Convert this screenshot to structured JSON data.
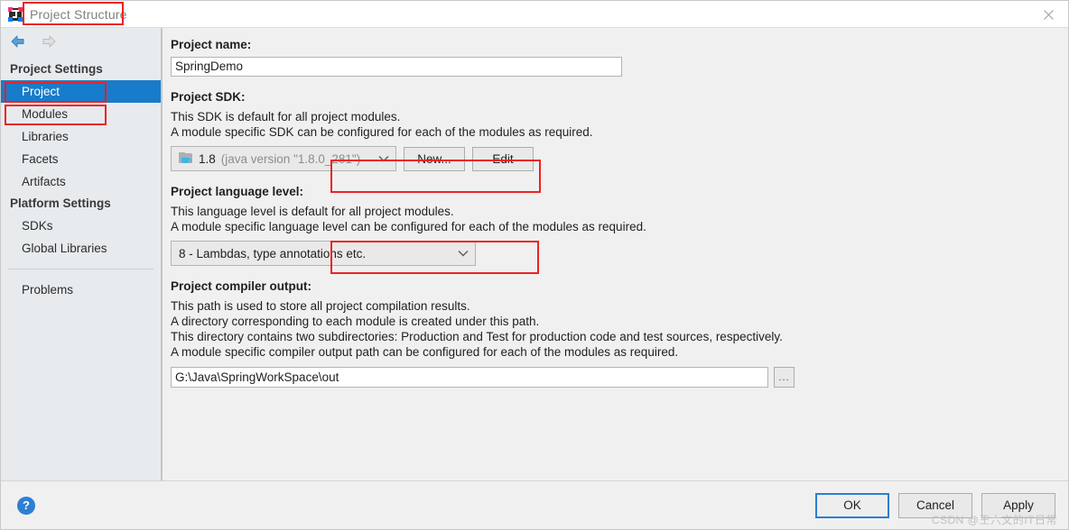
{
  "window": {
    "title": "Project Structure",
    "app_icon": "intellij-idea-icon",
    "close_label": "✕"
  },
  "sidebar": {
    "nav": {
      "back_icon": "arrow-left-icon",
      "forward_icon": "arrow-right-icon"
    },
    "groups": [
      {
        "label": "Project Settings",
        "items": [
          {
            "label": "Project",
            "selected": true
          },
          {
            "label": "Modules",
            "selected": false
          },
          {
            "label": "Libraries",
            "selected": false
          },
          {
            "label": "Facets",
            "selected": false
          },
          {
            "label": "Artifacts",
            "selected": false
          }
        ]
      },
      {
        "label": "Platform Settings",
        "items": [
          {
            "label": "SDKs",
            "selected": false
          },
          {
            "label": "Global Libraries",
            "selected": false
          }
        ]
      }
    ],
    "problems": {
      "label": "Problems"
    }
  },
  "main": {
    "project_name": {
      "label": "Project name:",
      "value": "SpringDemo",
      "placeholder": ""
    },
    "project_sdk": {
      "label": "Project SDK:",
      "desc_line1": "This SDK is default for all project modules.",
      "desc_line2": "A module specific SDK can be configured for each of the modules as required.",
      "selected_name": "1.8",
      "selected_version": "(java version \"1.8.0_281\")",
      "icon": "jdk-folder-icon",
      "dropdown_icon": "chevron-down-icon",
      "new_button": "New...",
      "edit_button": "Edit"
    },
    "language_level": {
      "label": "Project language level:",
      "desc_line1": "This language level is default for all project modules.",
      "desc_line2": "A module specific language level can be configured for each of the modules as required.",
      "selected": "8 - Lambdas, type annotations etc.",
      "dropdown_icon": "chevron-down-icon"
    },
    "compiler_output": {
      "label": "Project compiler output:",
      "desc_line1": "This path is used to store all project compilation results.",
      "desc_line2": "A directory corresponding to each module is created under this path.",
      "desc_line3": "This directory contains two subdirectories: Production and Test for production code and test sources, respectively.",
      "desc_line4": "A module specific compiler output path can be configured for each of the modules as required.",
      "value": "G:\\Java\\SpringWorkSpace\\out",
      "browse_button": "..."
    }
  },
  "footer": {
    "help_label": "?",
    "ok_label": "OK",
    "cancel_label": "Cancel",
    "apply_label": "Apply"
  },
  "watermark": {
    "text": "CSDN @王六文的IT日常"
  },
  "colors": {
    "selection_blue": "#177ccb",
    "annotation_red": "#ee2222",
    "default_button_border": "#2a7fd4",
    "sidebar_bg": "#e7ebee",
    "content_bg": "#f0f0f0"
  }
}
